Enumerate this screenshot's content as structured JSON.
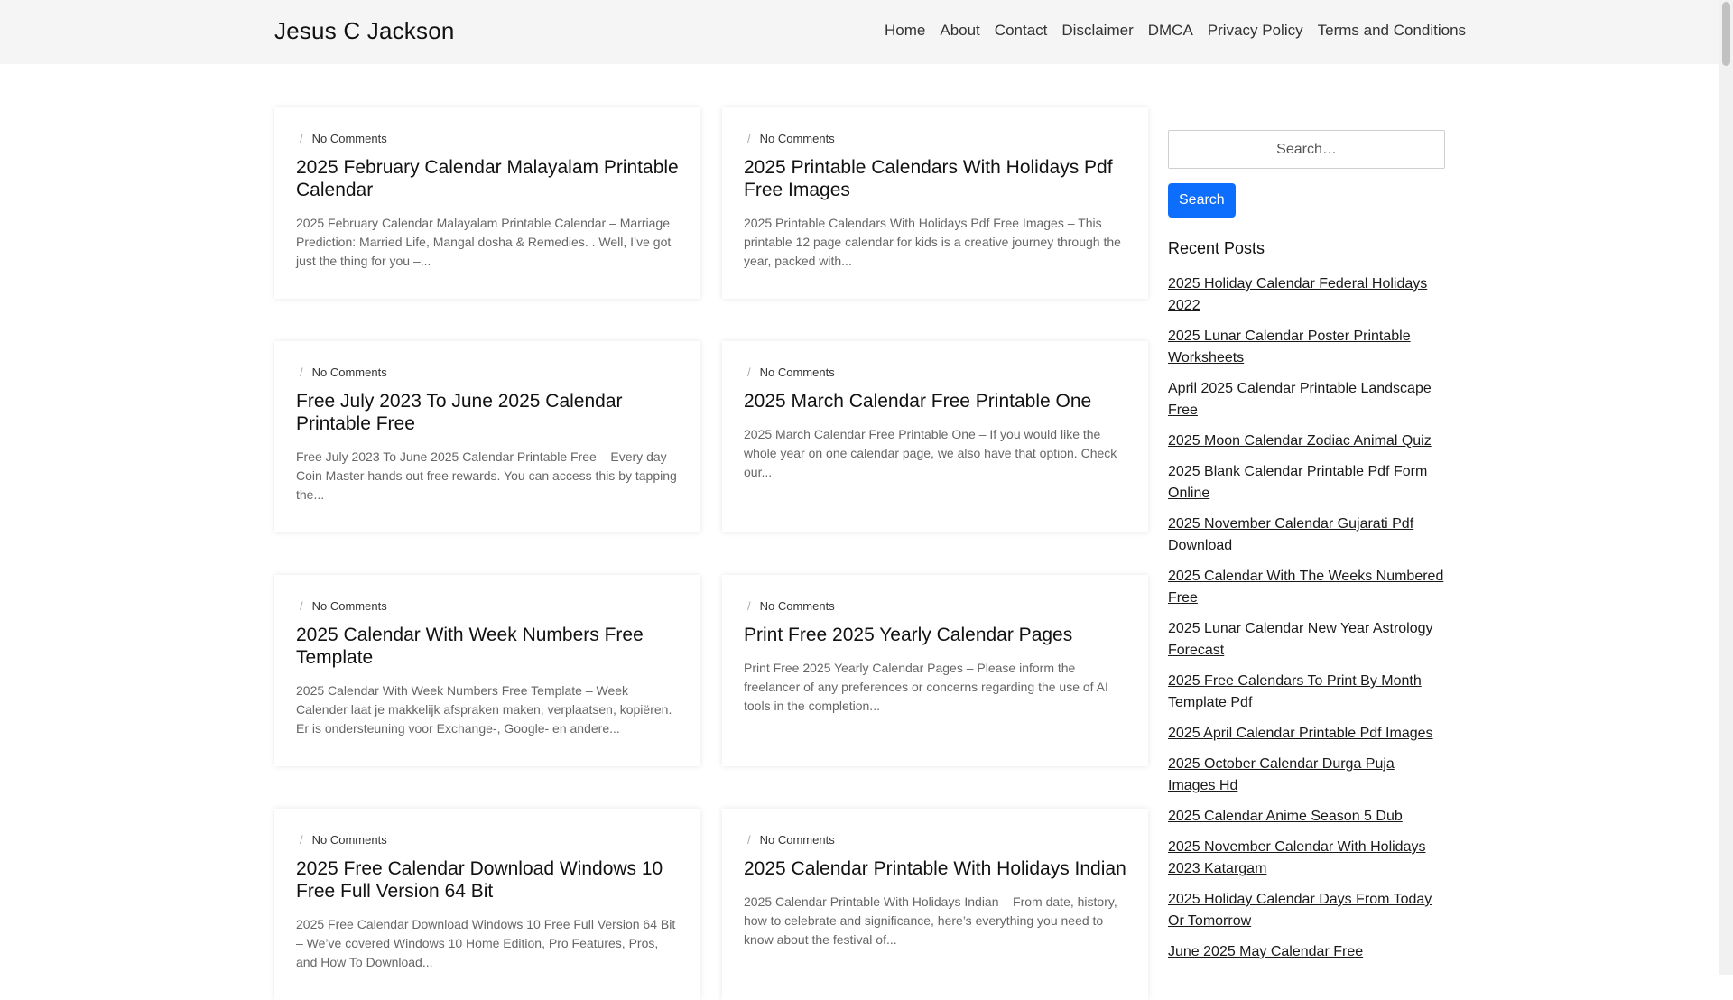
{
  "site": {
    "title": "Jesus C Jackson"
  },
  "nav": [
    {
      "label": "Home"
    },
    {
      "label": "About"
    },
    {
      "label": "Contact"
    },
    {
      "label": "Disclaimer"
    },
    {
      "label": "DMCA"
    },
    {
      "label": "Privacy Policy"
    },
    {
      "label": "Terms and Conditions"
    }
  ],
  "posts": [
    {
      "meta_sep": "/",
      "comments": "No Comments",
      "title": "2025 February Calendar Malayalam Printable Calendar",
      "excerpt": "2025 February Calendar Malayalam Printable Calendar – Marriage Prediction: Married Life, Mangal dosha & Remedies. . Well, I’ve got just the thing for you –..."
    },
    {
      "meta_sep": "/",
      "comments": "No Comments",
      "title": "2025 Printable Calendars With Holidays Pdf Free Images",
      "excerpt": "2025 Printable Calendars With Holidays Pdf Free Images – This printable 12 page calendar for kids is a creative journey through the year, packed with..."
    },
    {
      "meta_sep": "/",
      "comments": "No Comments",
      "title": "Free July 2023 To June 2025 Calendar Printable Free",
      "excerpt": "Free July 2023 To June 2025 Calendar Printable Free – Every day Coin Master hands out free rewards. You can access this by tapping the..."
    },
    {
      "meta_sep": "/",
      "comments": "No Comments",
      "title": "2025 March Calendar Free Printable One",
      "excerpt": "2025 March Calendar Free Printable One – If you would like the whole year on one calendar page, we also have that option. Check our..."
    },
    {
      "meta_sep": "/",
      "comments": "No Comments",
      "title": "2025 Calendar With Week Numbers Free Template",
      "excerpt": "2025 Calendar With Week Numbers Free Template – Week Calender laat je makkelijk afspraken maken, verplaatsen, kopiëren. Er is ondersteuning voor Exchange-, Google- en andere..."
    },
    {
      "meta_sep": "/",
      "comments": "No Comments",
      "title": "Print Free 2025 Yearly Calendar Pages",
      "excerpt": "Print Free 2025 Yearly Calendar Pages – Please inform the freelancer of any preferences or concerns regarding the use of AI tools in the completion..."
    },
    {
      "meta_sep": "/",
      "comments": "No Comments",
      "title": "2025 Free Calendar Download Windows 10 Free Full Version 64 Bit",
      "excerpt": "2025 Free Calendar Download Windows 10 Free Full Version 64 Bit – We’ve covered Windows 10 Home Edition, Pro Features, Pros, and How To Download..."
    },
    {
      "meta_sep": "/",
      "comments": "No Comments",
      "title": "2025 Calendar Printable With Holidays Indian",
      "excerpt": "2025 Calendar Printable With Holidays Indian – From date, history, how to celebrate and significance, here’s everything you need to know about the festival of..."
    }
  ],
  "sidebar": {
    "search_placeholder": "Search…",
    "search_button": "Search",
    "recent_title": "Recent Posts",
    "recent_posts": [
      "2025 Holiday Calendar Federal Holidays 2022",
      "2025 Lunar Calendar Poster Printable Worksheets",
      "April 2025 Calendar Printable Landscape Free",
      "2025 Moon Calendar Zodiac Animal Quiz",
      "2025 Blank Calendar Printable Pdf Form Online",
      "2025 November Calendar Gujarati Pdf Download",
      "2025 Calendar With The Weeks Numbered Free",
      "2025 Lunar Calendar New Year Astrology Forecast",
      "2025 Free Calendars To Print By Month Template Pdf",
      "2025 April Calendar Printable Pdf Images",
      "2025 October Calendar Durga Puja Images Hd",
      "2025 Calendar Anime Season 5 Dub",
      "2025 November Calendar With Holidays 2023 Katargam",
      "2025 Holiday Calendar Days From Today Or Tomorrow",
      "June 2025 May Calendar Free"
    ]
  },
  "colors": {
    "accent": "#0d6efd",
    "header_bg": "#f5f5f5"
  }
}
